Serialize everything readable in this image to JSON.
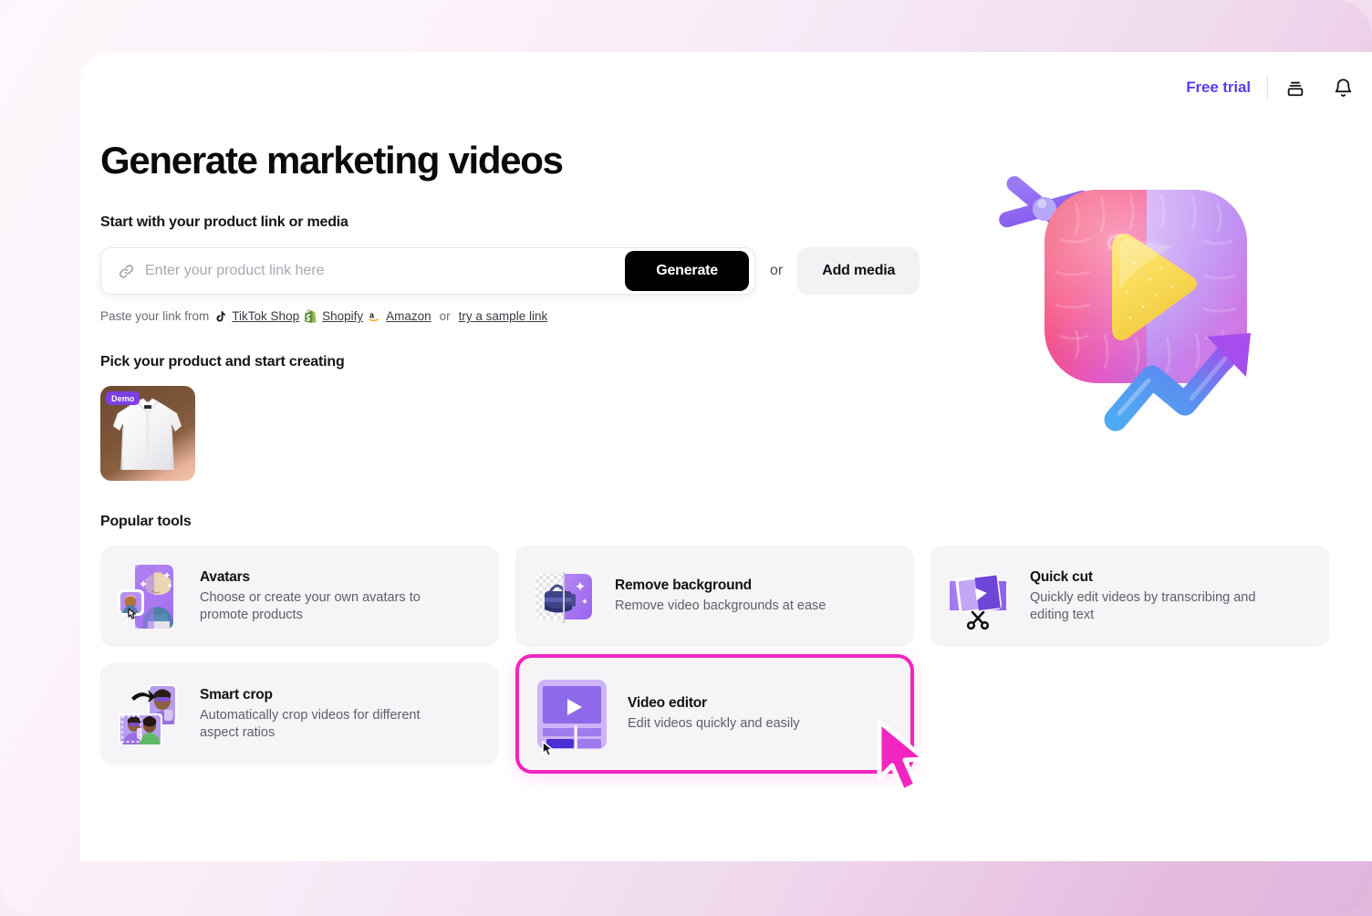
{
  "header": {
    "free_trial_label": "Free trial",
    "icons": [
      {
        "name": "layers-icon"
      },
      {
        "name": "bell-icon"
      }
    ]
  },
  "main": {
    "page_title": "Generate marketing videos",
    "start_section_label": "Start with your product link or media",
    "link_input": {
      "placeholder": "Enter your product link here",
      "value": ""
    },
    "generate_button": "Generate",
    "or_text": "or",
    "add_media_button": "Add media",
    "paste_row": {
      "prefix": "Paste your link from",
      "sources": [
        {
          "label": "TikTok Shop",
          "icon": "tiktok-icon"
        },
        {
          "label": "Shopify",
          "icon": "shopify-icon"
        },
        {
          "label": "Amazon",
          "icon": "amazon-icon"
        }
      ],
      "or_text": "or",
      "sample_link": "try a sample link"
    },
    "product_section_label": "Pick your product and start creating",
    "product": {
      "badge": "Demo",
      "alt": "white-dress-shirt"
    },
    "tools_section_label": "Popular tools",
    "tools": [
      {
        "title": "Avatars",
        "desc": "Choose or create your own avatars to promote products",
        "art": "avatars-art",
        "highlighted": false
      },
      {
        "title": "Remove background",
        "desc": "Remove video backgrounds at ease",
        "art": "remove-bg-art",
        "highlighted": false
      },
      {
        "title": "Quick cut",
        "desc": "Quickly edit videos by transcribing and editing text",
        "art": "quick-cut-art",
        "highlighted": false
      },
      {
        "title": "Smart crop",
        "desc": "Automatically crop videos for different aspect ratios",
        "art": "smart-crop-art",
        "highlighted": false
      },
      {
        "title": "Video editor",
        "desc": "Edit videos quickly and easily",
        "art": "video-editor-art",
        "highlighted": true
      }
    ]
  },
  "colors": {
    "accent_purple": "#5b3ef0",
    "highlight_pink": "#f225c0",
    "badge_purple": "#7b3fe4",
    "button_black": "#000000",
    "card_gray": "#f5f5f7",
    "page_bg_start": "#fdf8fd",
    "page_bg_end": "#e2b5dc"
  }
}
